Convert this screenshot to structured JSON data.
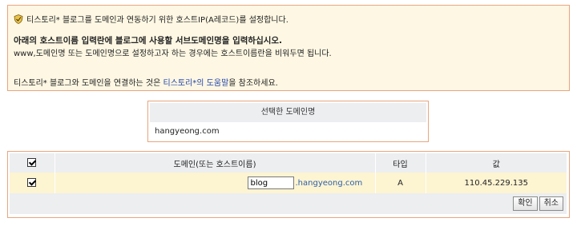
{
  "info": {
    "line1": "티스토리* 블로그를 도메인과 연동하기 위한 호스트IP(A레코드)를 설정합니다.",
    "line2": "아래의 호스트이름 입력란에 블로그에 사용할 서브도메인명을 입력하십시오.",
    "line3": "www,도메인명 또는 도메인명으로 설정하고자 하는 경우에는 호스트이름란을 비워두면 됩니다.",
    "line4_prefix": "티스토리* 블로그와 도메인을 연결하는 것은 ",
    "line4_link": "티스토리*의 도움말",
    "line4_suffix": "을 참조하세요."
  },
  "selected_domain": {
    "header": "선택한 도메인명",
    "value": "hangyeong.com"
  },
  "table": {
    "headers": {
      "domain": "도메인(또는 호스트이름)",
      "type": "타입",
      "value": "값"
    },
    "row": {
      "host_value": "blog",
      "suffix": ".hangyeong.com",
      "type": "A",
      "ip": "110.45.229.135"
    },
    "buttons": {
      "confirm": "확인",
      "cancel": "취소"
    }
  }
}
